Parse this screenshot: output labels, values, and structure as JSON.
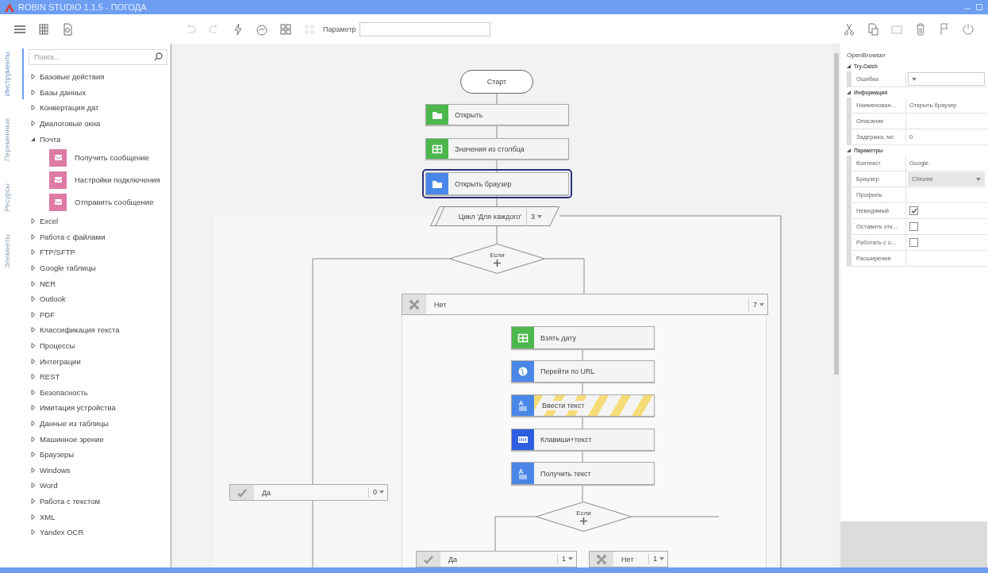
{
  "window": {
    "title": "ROBIN STUDIO 1.1.5 - ПОГОДА"
  },
  "toolbar": {
    "parameter_label": "Параметр"
  },
  "side_tabs": [
    {
      "label": "Инструменты",
      "selected": true
    },
    {
      "label": "Переменные",
      "selected": false
    },
    {
      "label": "Ресурсы",
      "selected": false
    },
    {
      "label": "Элементы",
      "selected": false
    }
  ],
  "sidebar": {
    "search": {
      "placeholder": "Поиск..."
    },
    "items": [
      {
        "label": "Базовые действия",
        "expanded": false
      },
      {
        "label": "Базы данных",
        "expanded": false
      },
      {
        "label": "Конвертация дат",
        "expanded": false
      },
      {
        "label": "Диалоговые окна",
        "expanded": false
      },
      {
        "label": "Почта",
        "expanded": true,
        "children": [
          {
            "label": "Получить сообщение"
          },
          {
            "label": "Настройки подключения"
          },
          {
            "label": "Отправить сообщение"
          }
        ]
      },
      {
        "label": "Excel",
        "expanded": false
      },
      {
        "label": "Работа с файлами",
        "expanded": false
      },
      {
        "label": "FTP/SFTP",
        "expanded": false
      },
      {
        "label": "Google таблицы",
        "expanded": false
      },
      {
        "label": "NER",
        "expanded": false
      },
      {
        "label": "Outlook",
        "expanded": false
      },
      {
        "label": "PDF",
        "expanded": false
      },
      {
        "label": "Классификация текста",
        "expanded": false
      },
      {
        "label": "Процессы",
        "expanded": false
      },
      {
        "label": "Интеграции",
        "expanded": false
      },
      {
        "label": "REST",
        "expanded": false
      },
      {
        "label": "Безопасность",
        "expanded": false
      },
      {
        "label": "Имитация устройства",
        "expanded": false
      },
      {
        "label": "Данные из таблицы",
        "expanded": false
      },
      {
        "label": "Машинное зрение",
        "expanded": false
      },
      {
        "label": "Браузеры",
        "expanded": false
      },
      {
        "label": "Windows",
        "expanded": false
      },
      {
        "label": "Word",
        "expanded": false
      },
      {
        "label": "Работа с текстом",
        "expanded": false
      },
      {
        "label": "XML",
        "expanded": false
      },
      {
        "label": "Yandex OCR",
        "expanded": false
      }
    ]
  },
  "flow": {
    "nodes": [
      {
        "kind": "terminal",
        "label": "Старт"
      },
      {
        "kind": "action",
        "label": "Открыть",
        "color": "#4cb84c",
        "selected": false,
        "highlighted": false
      },
      {
        "kind": "action",
        "label": "Значения из столбца",
        "color": "#4cb84c",
        "selected": false,
        "highlighted": false
      },
      {
        "kind": "action",
        "label": "Открыть браузер",
        "color": "#4a86e8",
        "selected": true,
        "highlighted": false
      },
      {
        "kind": "loop",
        "label": "Цикл 'Для каждого'",
        "count": "3"
      },
      {
        "kind": "decision",
        "label": "Если"
      },
      {
        "kind": "yes",
        "label": "Да",
        "count": "0"
      },
      {
        "kind": "no",
        "label": "Нет",
        "count": "7"
      },
      {
        "kind": "action",
        "label": "Взять дату",
        "color": "#4cb84c",
        "selected": false,
        "highlighted": false
      },
      {
        "kind": "action",
        "label": "Перейти по URL",
        "color": "#4a86e8",
        "selected": false,
        "highlighted": false
      },
      {
        "kind": "action",
        "label": "Ввести текст",
        "color": "#4a86e8",
        "selected": false,
        "highlighted": true
      },
      {
        "kind": "action",
        "label": "Клавиши+текст",
        "color": "#2f5fe0",
        "selected": false,
        "highlighted": false
      },
      {
        "kind": "action",
        "label": "Получить текст",
        "color": "#4a86e8",
        "selected": false,
        "highlighted": false
      },
      {
        "kind": "decision",
        "label": "Если"
      },
      {
        "kind": "yes",
        "label": "Да",
        "count": "1"
      },
      {
        "kind": "no",
        "label": "Нет",
        "count": "1"
      }
    ]
  },
  "properties": {
    "title": "OpenBrowser",
    "groups": [
      {
        "label": "Try-Catch",
        "expanded": true,
        "rows": [
          {
            "label": "Ошибка",
            "kind": "dropdown",
            "disabled": false
          }
        ]
      },
      {
        "label": "Информация",
        "expanded": true,
        "rows": [
          {
            "label": "Наименован...",
            "kind": "text",
            "value": "Открыть браузер",
            "disabled": false
          },
          {
            "label": "Описание",
            "kind": "text",
            "disabled": false
          },
          {
            "label": "Задержка, мс",
            "kind": "text",
            "value": "0",
            "disabled": false
          }
        ]
      },
      {
        "label": "Параметры",
        "expanded": true,
        "rows": [
          {
            "label": "Контекст",
            "kind": "text",
            "value": "Google",
            "disabled": false
          },
          {
            "label": "Браузер",
            "kind": "dropdown",
            "value": "Chrome",
            "disabled": true
          },
          {
            "label": "Профиль",
            "kind": "text",
            "disabled": false
          },
          {
            "label": "Невидимый",
            "kind": "checkbox",
            "checked": true,
            "disabled": false
          },
          {
            "label": "Оставить отк...",
            "kind": "checkbox",
            "checked": false,
            "disabled": false
          },
          {
            "label": "Работать с о...",
            "kind": "checkbox",
            "checked": false,
            "disabled": false
          },
          {
            "label": "Расширения",
            "kind": "text",
            "disabled": false
          }
        ]
      }
    ]
  }
}
